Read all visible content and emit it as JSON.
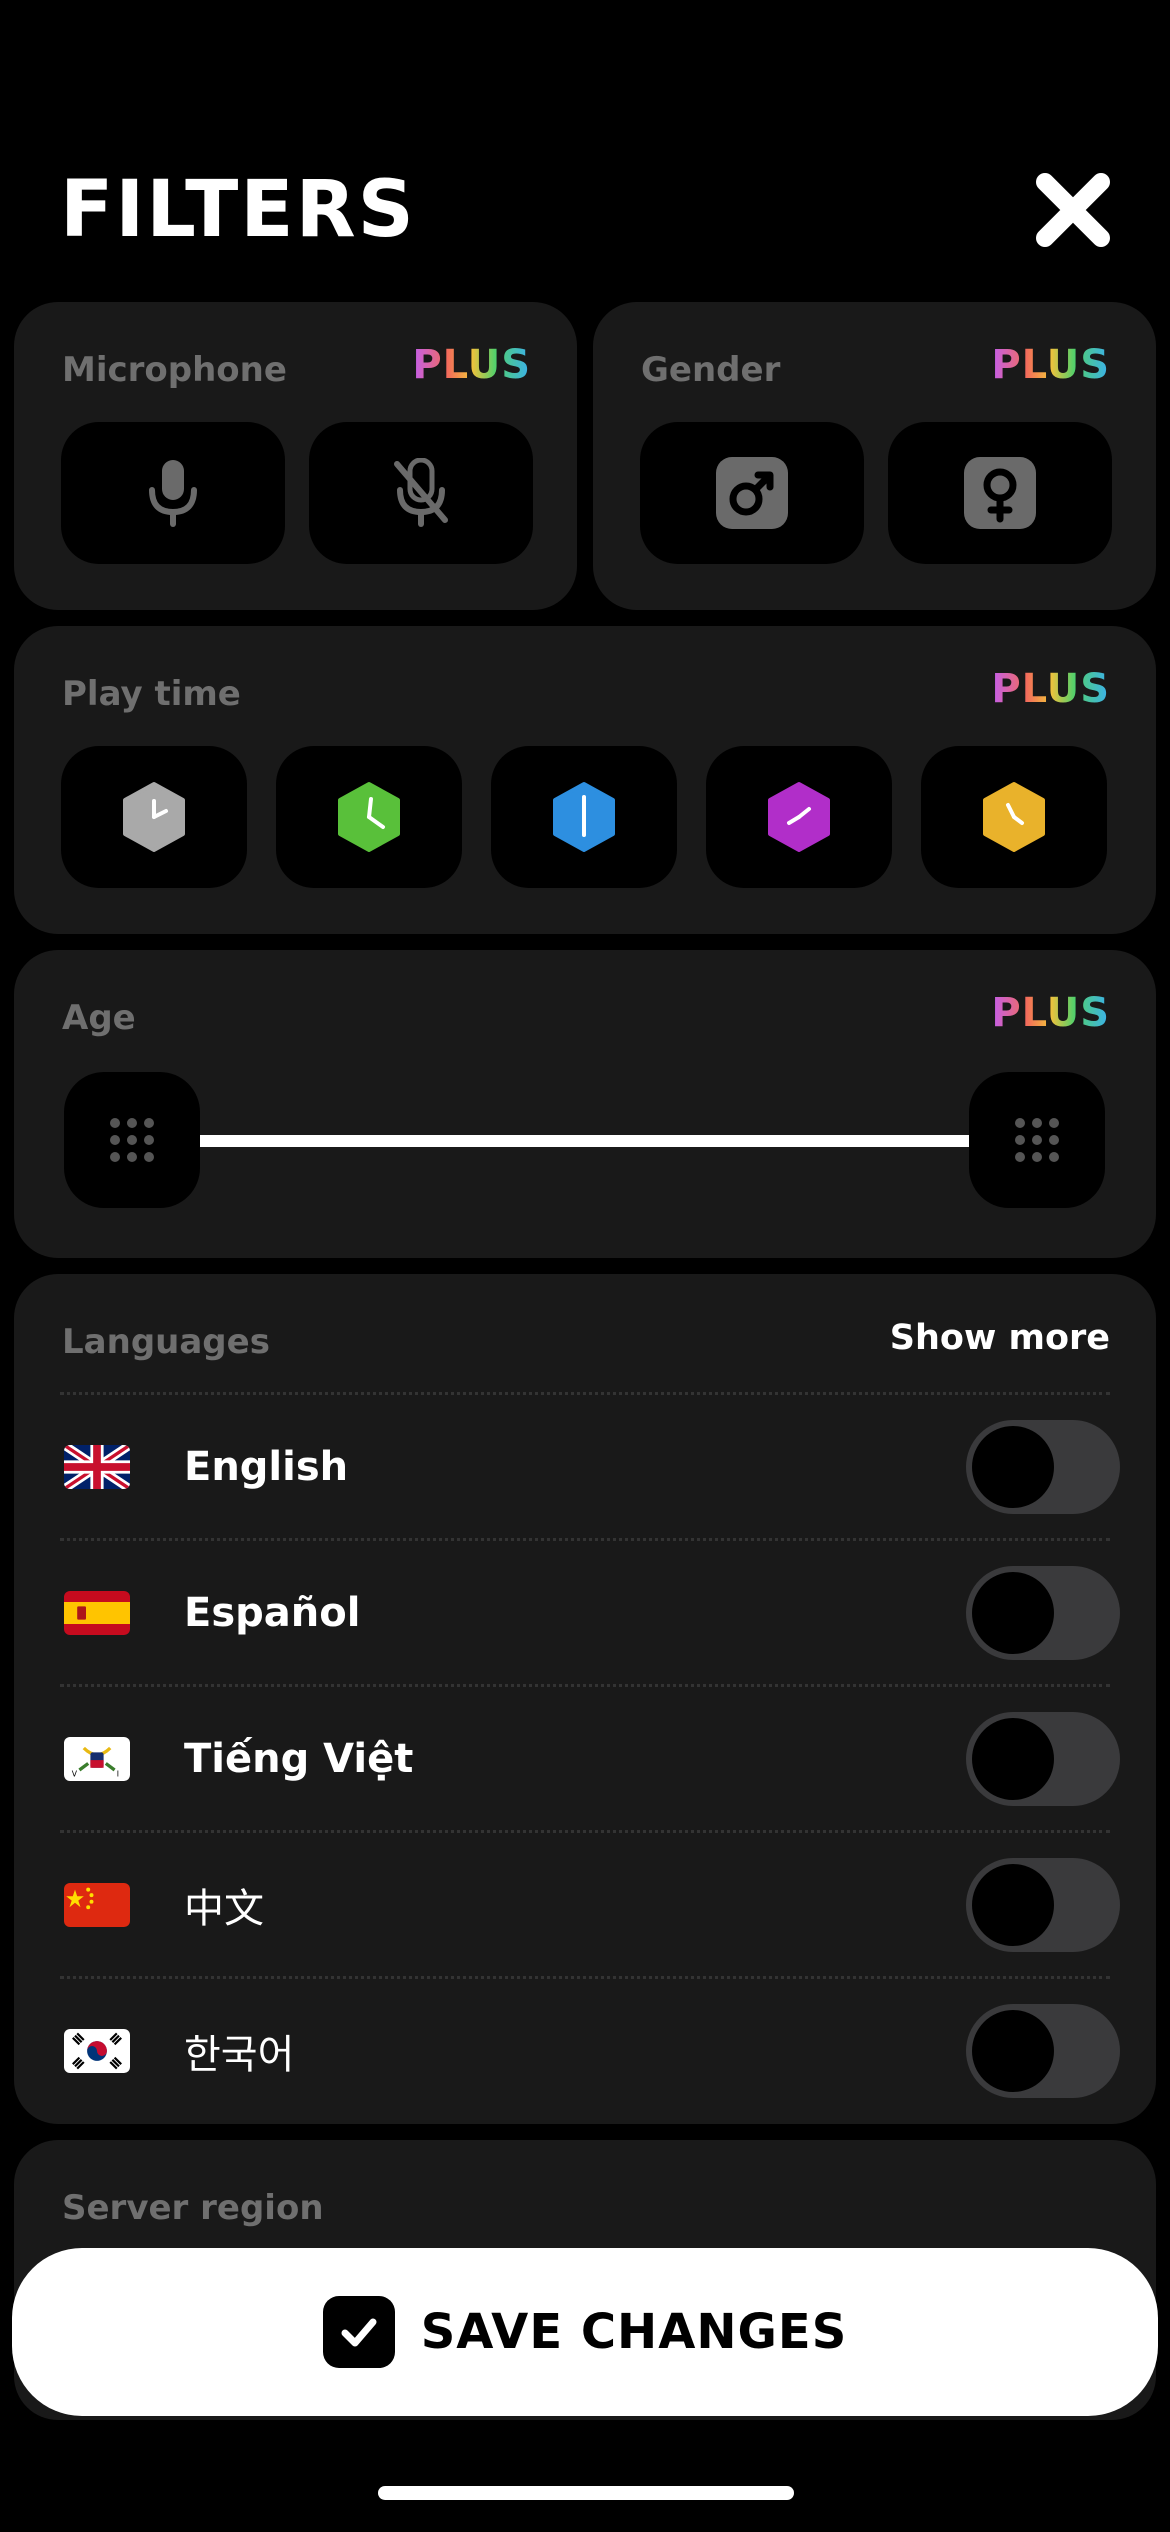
{
  "header": {
    "title": "FILTERS"
  },
  "badge": {
    "plus": "PLUS"
  },
  "microphone": {
    "label": "Microphone",
    "options": [
      "microphone-on-icon",
      "microphone-off-icon"
    ]
  },
  "gender": {
    "label": "Gender",
    "options": [
      "male-icon",
      "female-icon"
    ]
  },
  "playtime": {
    "label": "Play time",
    "options": [
      {
        "icon": "clock-gray-icon",
        "color": "#a9a9a9"
      },
      {
        "icon": "clock-green-icon",
        "color": "#59c03a"
      },
      {
        "icon": "clock-blue-icon",
        "color": "#2d8fe0"
      },
      {
        "icon": "clock-purple-icon",
        "color": "#b12ec9"
      },
      {
        "icon": "clock-yellow-icon",
        "color": "#e9b22b"
      }
    ]
  },
  "age": {
    "label": "Age",
    "range_min_fraction": 0.0,
    "range_max_fraction": 1.0
  },
  "languages": {
    "label": "Languages",
    "show_more": "Show more",
    "items": [
      {
        "name": "English",
        "enabled": false
      },
      {
        "name": "Español",
        "enabled": false
      },
      {
        "name": "Tiếng Việt",
        "enabled": false
      },
      {
        "name": "中文",
        "enabled": false
      },
      {
        "name": "한국어",
        "enabled": false
      }
    ]
  },
  "server_region": {
    "label": "Server region"
  },
  "save": {
    "label": "SAVE CHANGES"
  },
  "colors": {
    "background": "#000000",
    "card": "#191919",
    "muted_text": "#6f6f6f",
    "toggle_off": "#3a3a3c"
  }
}
